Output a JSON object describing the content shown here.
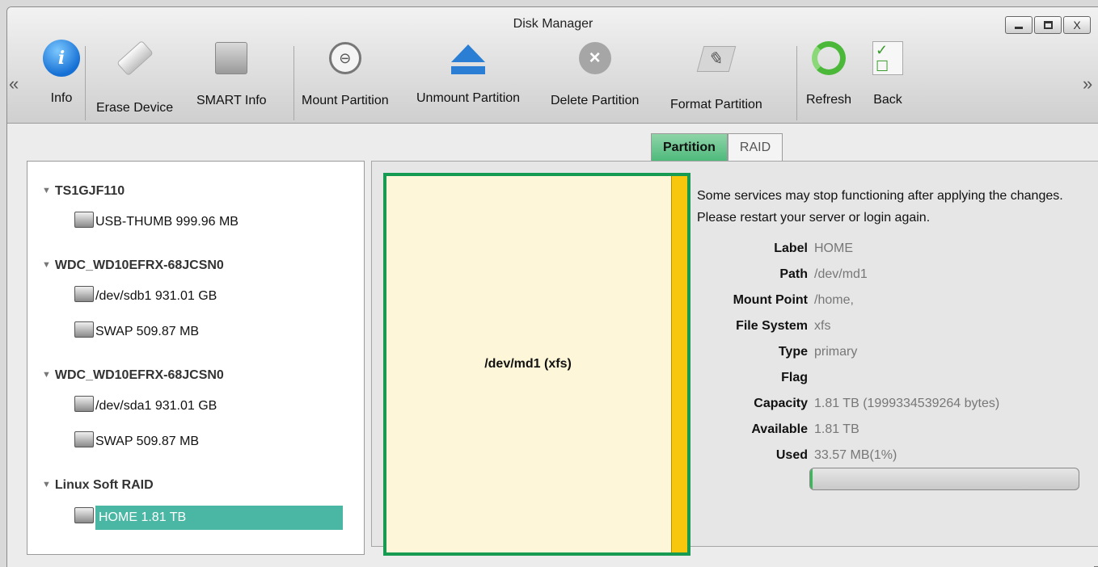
{
  "window": {
    "title": "Disk Manager",
    "controls": {
      "minimize": "_",
      "maximize": "□",
      "close": "X"
    }
  },
  "toolbar": {
    "scroll_left": "«",
    "scroll_right": "»",
    "buttons": [
      {
        "label": "Info",
        "icon": "info-icon"
      },
      {
        "label": "Erase Device",
        "icon": "eraser-icon"
      },
      {
        "label": "SMART Info",
        "icon": "smart-disk-icon"
      },
      {
        "label": "Mount Partition",
        "icon": "mount-icon"
      },
      {
        "label": "Unmount Partition",
        "icon": "eject-icon"
      },
      {
        "label": "Delete Partition",
        "icon": "delete-icon"
      },
      {
        "label": "Format Partition",
        "icon": "format-icon"
      },
      {
        "label": "Refresh",
        "icon": "refresh-icon"
      },
      {
        "label": "Back",
        "icon": "checklist-icon"
      }
    ]
  },
  "tabs": [
    {
      "label": "Partition",
      "active": true
    },
    {
      "label": "RAID",
      "active": false
    }
  ],
  "tree": {
    "groups": [
      {
        "label": "TS1GJF110",
        "items": [
          {
            "label": "USB-THUMB 999.96 MB"
          }
        ]
      },
      {
        "label": "WDC_WD10EFRX-68JCSN0",
        "items": [
          {
            "label": "/dev/sdb1 931.01 GB"
          },
          {
            "label": "SWAP 509.87 MB"
          }
        ]
      },
      {
        "label": "WDC_WD10EFRX-68JCSN0",
        "items": [
          {
            "label": "/dev/sda1 931.01 GB"
          },
          {
            "label": "SWAP 509.87 MB"
          }
        ]
      },
      {
        "label": "Linux Soft RAID",
        "items": [
          {
            "label": "HOME 1.81 TB",
            "selected": true
          }
        ]
      }
    ]
  },
  "partition": {
    "label": "/dev/md1 (xfs)",
    "colors": {
      "border": "#179a52",
      "fill": "#fdf6d8",
      "used": "#f6c70c"
    }
  },
  "details": {
    "notice": "Some services may stop functioning after applying the changes. Please restart your server or login again.",
    "properties": [
      {
        "key": "Label",
        "value": "HOME"
      },
      {
        "key": "Path",
        "value": "/dev/md1"
      },
      {
        "key": "Mount Point",
        "value": "/home,"
      },
      {
        "key": "File System",
        "value": "xfs"
      },
      {
        "key": "Type",
        "value": "primary"
      },
      {
        "key": "Flag",
        "value": ""
      },
      {
        "key": "Capacity",
        "value": "1.81 TB (1999334539264 bytes)"
      },
      {
        "key": "Available",
        "value": "1.81 TB"
      },
      {
        "key": "Used",
        "value": "33.57 MB(1%)"
      }
    ],
    "usage_fraction": 0.01
  }
}
